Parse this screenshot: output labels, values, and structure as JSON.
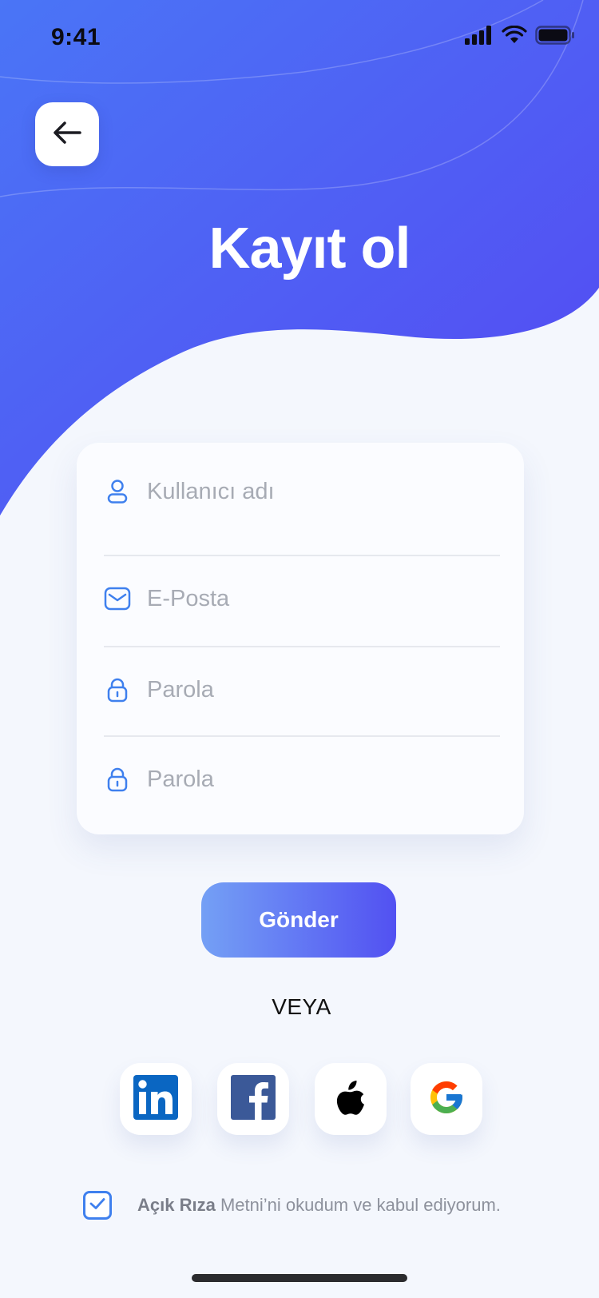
{
  "status_bar": {
    "time": "9:41",
    "icons": [
      "cellular-signal-icon",
      "wifi-icon",
      "battery-icon"
    ]
  },
  "header": {
    "back_icon": "arrow-left-icon",
    "title": "Kayıt ol"
  },
  "form": {
    "fields": [
      {
        "icon": "user-icon",
        "placeholder": "Kullanıcı adı",
        "value": ""
      },
      {
        "icon": "mail-icon",
        "placeholder": "E-Posta",
        "value": ""
      },
      {
        "icon": "lock-icon",
        "placeholder": "Parola",
        "value": ""
      },
      {
        "icon": "lock-icon",
        "placeholder": "Parola",
        "value": ""
      }
    ],
    "submit_label": "Gönder"
  },
  "divider_text": "VEYA",
  "social_buttons": [
    "linkedin-icon",
    "facebook-icon",
    "apple-icon",
    "google-icon"
  ],
  "consent": {
    "checked": true,
    "bold_text": "Açık Rıza",
    "text": " Metni’ni okudum ve kabul ediyorum."
  },
  "colors": {
    "gradient_start": "#4a72f5",
    "gradient_end": "#5449f3",
    "background": "#f4f7fd",
    "accent": "#3f80ee"
  }
}
